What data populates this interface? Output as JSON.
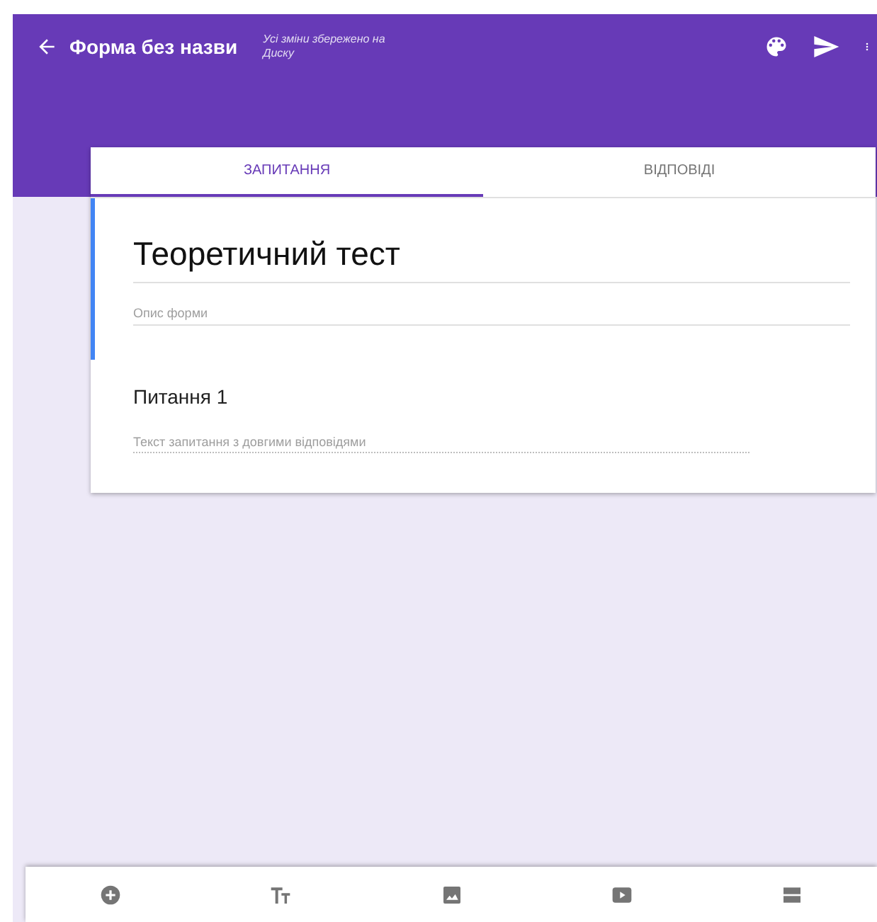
{
  "header": {
    "title": "Форма без назви",
    "save_status": "Усі зміни збережено на Диску"
  },
  "tabs": [
    {
      "label": "ЗАПИТАННЯ",
      "selected": true
    },
    {
      "label": "ВІДПОВІДІ",
      "selected": false
    }
  ],
  "form": {
    "title": "Теоретичний тест",
    "description_placeholder": "Опис форми",
    "focused": true
  },
  "questions": [
    {
      "title": "Питання 1",
      "placeholder": "Текст запитання з довгими відповідями"
    }
  ],
  "toolbar": [
    {
      "kind": "add"
    },
    {
      "kind": "title"
    },
    {
      "kind": "image"
    },
    {
      "kind": "video"
    },
    {
      "kind": "section"
    }
  ]
}
